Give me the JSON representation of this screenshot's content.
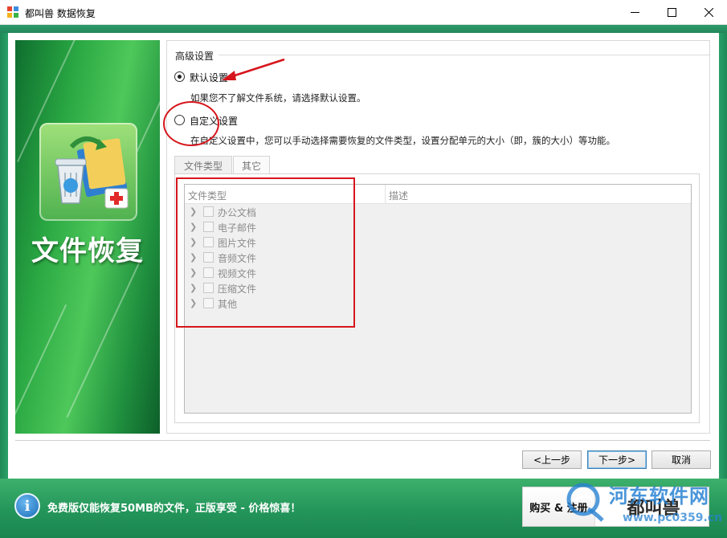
{
  "window": {
    "title": "都叫兽 数据恢复",
    "icons": {
      "app": "app-logo-icon",
      "minimize": "minimize-icon",
      "maximize": "maximize-icon",
      "close": "close-icon"
    }
  },
  "banner": {
    "title": "文件恢复",
    "icon": "recycle-bin-folder-icon"
  },
  "advanced": {
    "group_label": "高级设置",
    "default_option": {
      "label": "默认设置",
      "selected": true,
      "description": "如果您不了解文件系统，请选择默认设置。"
    },
    "custom_option": {
      "label": "自定义设置",
      "selected": false,
      "description": "在自定义设置中，您可以手动选择需要恢复的文件类型，设置分配单元的大小（即，簇的大小）等功能。"
    }
  },
  "tabs": [
    {
      "label": "文件类型",
      "active": true
    },
    {
      "label": "其它",
      "active": false
    }
  ],
  "tree": {
    "columns": [
      "文件类型",
      "描述"
    ],
    "items": [
      {
        "label": "办公文档"
      },
      {
        "label": "电子邮件"
      },
      {
        "label": "图片文件"
      },
      {
        "label": "音频文件"
      },
      {
        "label": "视频文件"
      },
      {
        "label": "压缩文件"
      },
      {
        "label": "其他"
      }
    ]
  },
  "buttons": {
    "prev": "<上一步",
    "next": "下一步>",
    "cancel": "取消"
  },
  "footer": {
    "info_icon": "info-icon",
    "promo": "免费版仅能恢复50MB的文件，正版享受 - 价格惊喜！",
    "buy_label": "购买 & 注册",
    "brand": "都叫兽"
  },
  "watermark": {
    "name": "河东软件网",
    "url": "www.pc0359.cn"
  },
  "colors": {
    "frame_green": "#22875a",
    "annotation_red": "#d6161c",
    "banner_green": "#2aa843",
    "next_border": "#3c7fb1"
  }
}
